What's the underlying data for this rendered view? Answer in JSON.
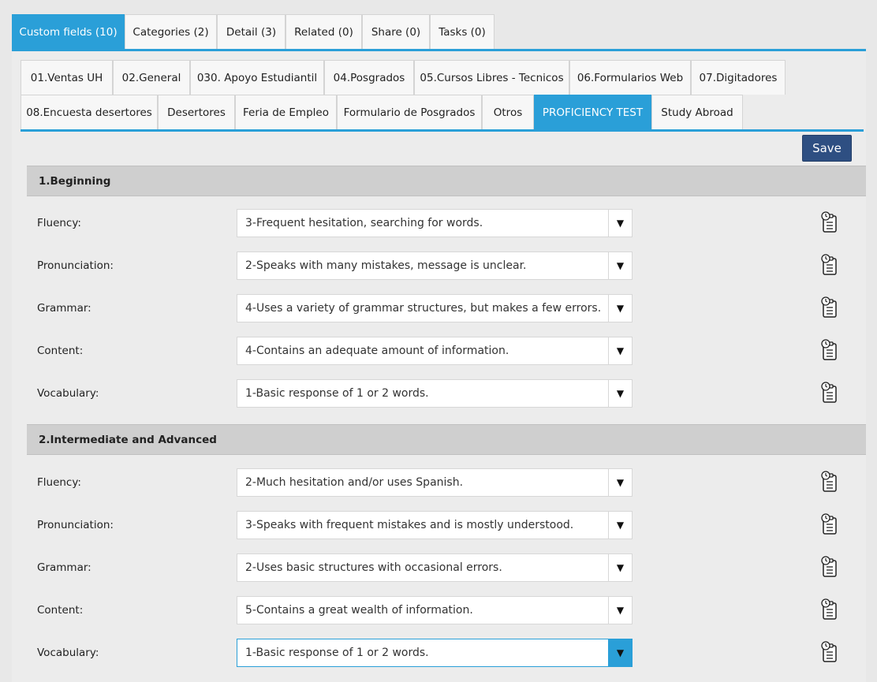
{
  "top_tabs": [
    {
      "label": "Custom fields (10)",
      "active": true
    },
    {
      "label": "Categories (2)",
      "active": false
    },
    {
      "label": "Detail (3)",
      "active": false
    },
    {
      "label": "Related (0)",
      "active": false
    },
    {
      "label": "Share (0)",
      "active": false
    },
    {
      "label": "Tasks (0)",
      "active": false
    }
  ],
  "sub_tabs_row1": [
    {
      "label": "01.Ventas UH"
    },
    {
      "label": "02.General"
    },
    {
      "label": "030. Apoyo Estudiantil"
    },
    {
      "label": "04.Posgrados"
    },
    {
      "label": "05.Cursos Libres - Tecnicos"
    },
    {
      "label": "06.Formularios Web"
    },
    {
      "label": "07.Digitadores"
    }
  ],
  "sub_tabs_row2": [
    {
      "label": "08.Encuesta desertores"
    },
    {
      "label": "Desertores"
    },
    {
      "label": "Feria de Empleo"
    },
    {
      "label": "Formulario de Posgrados"
    },
    {
      "label": "Otros"
    },
    {
      "label": "PROFICIENCY TEST",
      "active": true
    },
    {
      "label": "Study Abroad"
    }
  ],
  "save_label": "Save",
  "sections": [
    {
      "title": "1.Beginning",
      "fields": [
        {
          "label": "Fluency:",
          "value": "3-Frequent hesitation, searching for words."
        },
        {
          "label": "Pronunciation:",
          "value": "2-Speaks with many mistakes, message is unclear."
        },
        {
          "label": "Grammar:",
          "value": "4-Uses a variety of grammar structures, but makes a few errors."
        },
        {
          "label": "Content:",
          "value": "4-Contains an adequate amount of information."
        },
        {
          "label": "Vocabulary:",
          "value": "1-Basic response of 1 or 2 words."
        }
      ]
    },
    {
      "title": "2.Intermediate and Advanced",
      "fields": [
        {
          "label": "Fluency:",
          "value": "2-Much hesitation and/or uses Spanish."
        },
        {
          "label": "Pronunciation:",
          "value": "3-Speaks with frequent mistakes and is mostly understood."
        },
        {
          "label": "Grammar:",
          "value": "2-Uses basic structures with occasional errors."
        },
        {
          "label": "Content:",
          "value": "5-Contains a great wealth of information."
        },
        {
          "label": "Vocabulary:",
          "value": "1-Basic response of 1 or 2 words.",
          "focused": true
        }
      ]
    }
  ],
  "icons": {
    "dropdown": "dropdown-arrow-icon",
    "history": "history-clipboard-icon"
  },
  "colors": {
    "accent": "#2a9fd8",
    "save_button": "#2e4f82",
    "section_header": "#cfcfcf"
  }
}
